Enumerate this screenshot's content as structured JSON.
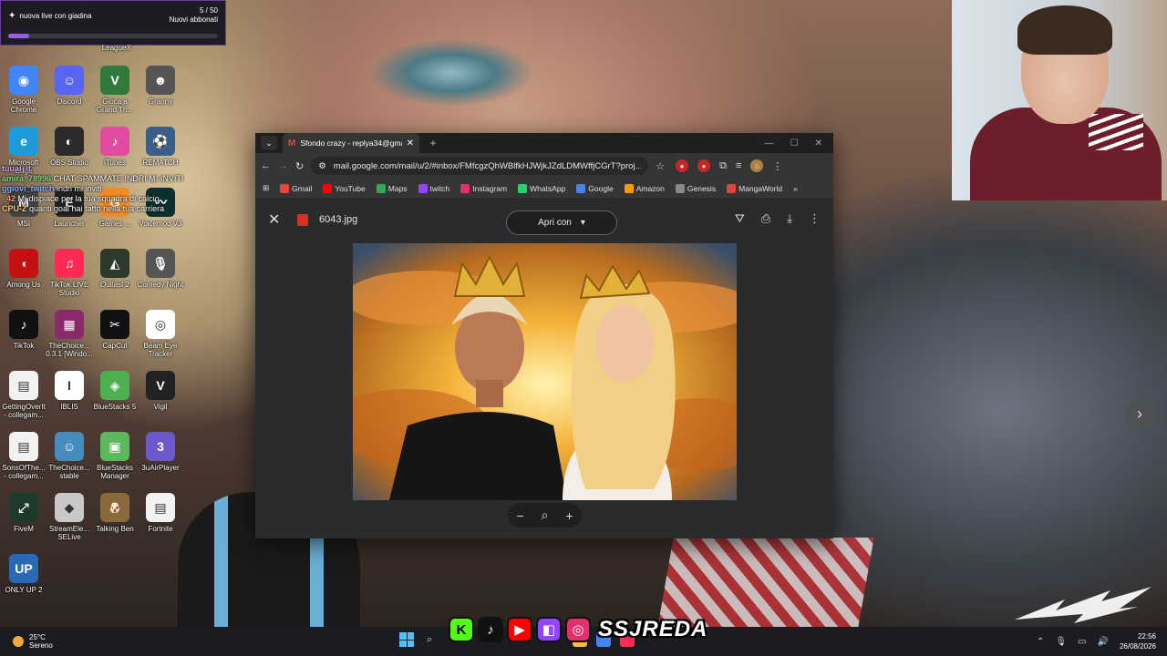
{
  "alert": {
    "title": "nuova live con giadina",
    "count": "5 / 50",
    "label": "Nuovi abbonati",
    "progress": 0.1
  },
  "desktop": {
    "top_label": "League®",
    "icons": [
      {
        "label": "Google Chrome",
        "icon": "chrome-icon",
        "color": "#4285f4",
        "glyph": "◉"
      },
      {
        "label": "Discord",
        "icon": "discord-icon",
        "color": "#5865f2",
        "glyph": "☺"
      },
      {
        "label": "Gioca a Grand Th...",
        "icon": "gta-icon",
        "color": "#2f7a3a",
        "glyph": "V"
      },
      {
        "label": "Granny",
        "icon": "granny-icon",
        "color": "#555555",
        "glyph": "☻"
      },
      {
        "label": "Microsoft Edge",
        "icon": "edge-icon",
        "color": "#1c9bd8",
        "glyph": "e"
      },
      {
        "label": "OBS Studio",
        "icon": "obs-icon",
        "color": "#2b2b2b",
        "glyph": "◐"
      },
      {
        "label": "iTunes",
        "icon": "itunes-icon",
        "color": "#e04ba0",
        "glyph": "♪"
      },
      {
        "label": "REMATCH",
        "icon": "rematch-icon",
        "color": "#3a5e8a",
        "glyph": "⚽"
      },
      {
        "label": "MSI",
        "icon": "msi-icon",
        "color": "#444444",
        "glyph": "M"
      },
      {
        "label": "Launcher",
        "icon": "epic-games-icon",
        "color": "#222222",
        "glyph": "E"
      },
      {
        "label": "Games ...",
        "icon": "ea-games-icon",
        "color": "#f08a24",
        "glyph": "G"
      },
      {
        "label": "Voicemod V3",
        "icon": "voicemod-icon",
        "color": "#0c2f2f",
        "glyph": "〰"
      },
      {
        "label": "Among Us",
        "icon": "among-us-icon",
        "color": "#c51111",
        "glyph": "◖"
      },
      {
        "label": "TikTok LIVE Studio",
        "icon": "tiktok-live-icon",
        "color": "#fe2c55",
        "glyph": "♫"
      },
      {
        "label": "Outlast 2",
        "icon": "outlast-icon",
        "color": "#2b3a2b",
        "glyph": "◭"
      },
      {
        "label": "Comedy Night",
        "icon": "comedy-night-icon",
        "color": "#555555",
        "glyph": "🎙"
      },
      {
        "label": "TikTok",
        "icon": "tiktok-icon",
        "color": "#111111",
        "glyph": "♪"
      },
      {
        "label": "TheChoice... 0.3.1 [Windo...",
        "icon": "winrar-icon",
        "color": "#8a2a6a",
        "glyph": "▦"
      },
      {
        "label": "CapCut",
        "icon": "capcut-icon",
        "color": "#111111",
        "glyph": "✂"
      },
      {
        "label": "Beam Eye Tracker",
        "icon": "beam-icon",
        "color": "#ffffff",
        "glyph": "◎"
      },
      {
        "label": "GettingOverIt - collegam...",
        "icon": "file-icon",
        "color": "#f2f2f2",
        "glyph": "▤"
      },
      {
        "label": "IBLIS",
        "icon": "iblis-icon",
        "color": "#ffffff",
        "glyph": "I"
      },
      {
        "label": "BlueStacks 5",
        "icon": "bluestacks-icon",
        "color": "#4caf50",
        "glyph": "◈"
      },
      {
        "label": "Vigil",
        "icon": "vigil-icon",
        "color": "#222222",
        "glyph": "V"
      },
      {
        "label": "SonsOfThe... - collegam...",
        "icon": "file-icon",
        "color": "#f2f2f2",
        "glyph": "▤"
      },
      {
        "label": "TheChoice... stable",
        "icon": "godot-icon",
        "color": "#478cbf",
        "glyph": "☺"
      },
      {
        "label": "BlueStacks Manager",
        "icon": "bluestacks-manager-icon",
        "color": "#5cb85c",
        "glyph": "▣"
      },
      {
        "label": "3uAirPlayer",
        "icon": "airplayer-icon",
        "color": "#6a5acd",
        "glyph": "3"
      },
      {
        "label": "FiveM",
        "icon": "fivem-icon",
        "color": "#1e3a2a",
        "glyph": "⤢"
      },
      {
        "label": "StreamEle... SELive",
        "icon": "streamelements-icon",
        "color": "#c8c8c8",
        "glyph": "◆"
      },
      {
        "label": "Talking Ben",
        "icon": "talking-ben-icon",
        "color": "#8a6a3a",
        "glyph": "🐶"
      },
      {
        "label": "Fortnite",
        "icon": "file-icon",
        "color": "#f2f2f2",
        "glyph": "▤"
      },
      {
        "label": "ONLY UP 2",
        "icon": "only-up-icon",
        "color": "#2a6ab5",
        "glyph": "UP"
      }
    ]
  },
  "chat": [
    {
      "user": "tuuai_it",
      "text": "",
      "color": "#d9a0ff"
    },
    {
      "user": "amira_78996",
      "text": "CHAT SPAMMATE INDRI MI INVITI",
      "color": "#7fe07f"
    },
    {
      "user": "ggiovi_twitch",
      "text": "indri mi inviti",
      "color": "#8fb0ff"
    },
    {
      "user": "_42",
      "text": "Mi dispiace per la tua squadra di calcio",
      "color": "#ff9a6a"
    },
    {
      "user": "CPU-Z",
      "text": "quanti goal hai fatto nella tua carriera",
      "color": "#ffd26a"
    }
  ],
  "browser": {
    "tab_title": "Sfondo crazy - replya34@gmail.com",
    "url": "mail.google.com/mail/u/2/#inbox/FMfcgzQhWBlfkHJWjkJZdLDMWffjCGrT?proj...",
    "bookmarks": [
      {
        "label": "Gmail",
        "icon": "gmail-icon",
        "color": "#ea4335"
      },
      {
        "label": "YouTube",
        "icon": "youtube-icon",
        "color": "#ff0000"
      },
      {
        "label": "Maps",
        "icon": "maps-icon",
        "color": "#34a853"
      },
      {
        "label": "twitch",
        "icon": "twitch-icon",
        "color": "#9146ff"
      },
      {
        "label": "Instagram",
        "icon": "instagram-icon",
        "color": "#e1306c"
      },
      {
        "label": "WhatsApp",
        "icon": "whatsapp-icon",
        "color": "#25d366"
      },
      {
        "label": "Google",
        "icon": "google-icon",
        "color": "#4285f4"
      },
      {
        "label": "Amazon",
        "icon": "amazon-icon",
        "color": "#ff9900"
      },
      {
        "label": "Genesis",
        "icon": "genesis-icon",
        "color": "#888888"
      },
      {
        "label": "MangaWorld",
        "icon": "mangaworld-icon",
        "color": "#e0443a"
      }
    ],
    "viewer": {
      "filename": "6043.jpg",
      "open_with": "Apri con"
    }
  },
  "taskbar": {
    "temp": "25°C",
    "weather": "Sereno",
    "time": "22:56",
    "date": "26/08/2026"
  },
  "social": {
    "handle": "SSJREDA"
  }
}
